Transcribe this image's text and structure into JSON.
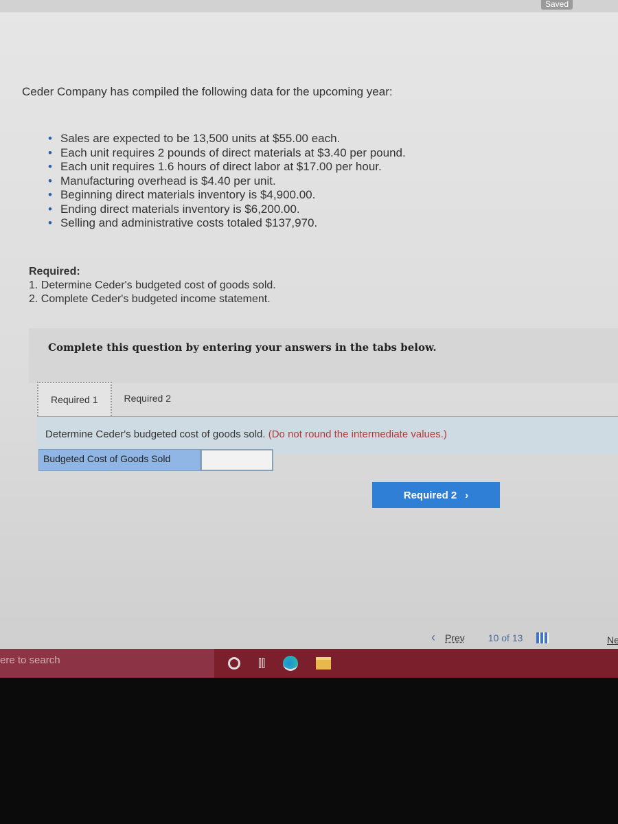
{
  "header": {
    "saved": "Saved"
  },
  "problem": {
    "intro": "Ceder Company has compiled the following data for the upcoming year:",
    "bullets": [
      "Sales are expected to be 13,500 units at $55.00 each.",
      "Each unit requires 2 pounds of direct materials at $3.40 per pound.",
      "Each unit requires 1.6 hours of direct labor at $17.00 per hour.",
      "Manufacturing overhead is $4.40 per unit.",
      "Beginning direct materials inventory is $4,900.00.",
      "Ending direct materials inventory is $6,200.00.",
      "Selling and administrative costs totaled $137,970."
    ],
    "required_heading": "Required:",
    "required_items": [
      "1. Determine Ceder's budgeted cost of goods sold.",
      "2. Complete Ceder's budgeted income statement."
    ]
  },
  "instructions": "Complete this question by entering your answers in the tabs below.",
  "tabs": [
    {
      "label": "Required 1",
      "active": true
    },
    {
      "label": "Required 2",
      "active": false
    }
  ],
  "panel": {
    "question": "Determine Ceder's budgeted cost of goods sold.",
    "note": "(Do not round the intermediate values.)",
    "answer_label": "Budgeted Cost of Goods Sold",
    "answer_value": ""
  },
  "next_button": {
    "label": "Required 2",
    "icon": "chevron-right-icon"
  },
  "pager": {
    "prev": "Prev",
    "current": "10",
    "of": "of",
    "total": "13",
    "next": "Ne"
  },
  "taskbar": {
    "search": "ere to search"
  },
  "colors": {
    "accent": "#2f7fd6",
    "taskbar": "#7b1f2c",
    "answer_label_bg": "#8fb6e4"
  }
}
